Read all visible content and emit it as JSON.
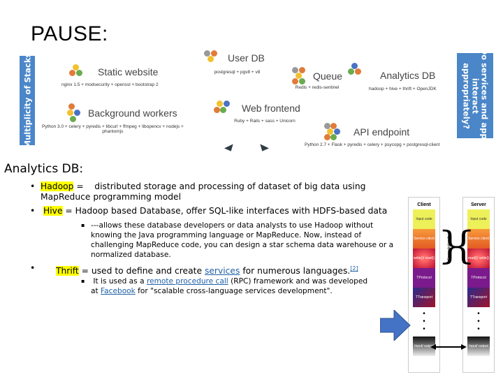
{
  "slide": {
    "title": "PAUSE:"
  },
  "diagram": {
    "left_banner": "Multiplicity of Stacks",
    "right_banner_lines": [
      "Do services and apps",
      "interact",
      "appropriately?"
    ],
    "services": [
      {
        "name": "Static website",
        "stack": "nginx 1.5 + modsecurity + openssl + bootstrap 2"
      },
      {
        "name": "User DB",
        "stack": "postgresql + pgv8 + v8"
      },
      {
        "name": "Queue",
        "stack": "Redis + redis-sentinel"
      },
      {
        "name": "Analytics DB",
        "stack": "hadoop + hive + thrift + OpenJDK"
      },
      {
        "name": "Background workers",
        "stack_lines": [
          "Python 3.0 + celery + pyredis + libcurl + ffmpeg + libopencv + nodejs +",
          "phantomjs"
        ]
      },
      {
        "name": "Web frontend",
        "stack": "Ruby + Rails + sass + Unicorn"
      },
      {
        "name": "API endpoint",
        "stack": "Python 2.7 + Flask + pyredis + celery + psycopg + postgresql-client"
      }
    ]
  },
  "content": {
    "heading": "Analytics DB:",
    "bullets": {
      "hadoop": {
        "term": "Hadoop",
        "text1": " =    distributed storage and processing of dataset of big data using",
        "text2": "MapReduce programming model"
      },
      "hive": {
        "term": "Hive",
        "text": " = Hadoop based Database, offer SQL-like interfaces with HDFS-based data"
      },
      "hive_sub": {
        "lines": [
          "---allows these database developers or data analysts to use Hadoop without",
          "knowing the Java programming language or MapReduce. Now, instead of",
          "challenging MapReduce code, you can design a star schema data warehouse or a",
          "normalized database."
        ]
      },
      "thrift": {
        "term": "Thrift",
        "text_a": " = used to define and create ",
        "link_services": "services",
        "text_b": " for numerous languages.",
        "ref": "[2]"
      },
      "thrift_sub": {
        "text_a": " It is used as a ",
        "link_rpc": "remote procedure call",
        "text_b": " (RPC) framework and was developed",
        "text_c": "at ",
        "link_fb": "Facebook",
        "text_d": " for \"scalable cross-language services development\"."
      }
    },
    "bullet_char": "•",
    "sub_bullet_char": "▪"
  },
  "thrift_diagram": {
    "client_title": "Client",
    "server_title": "Server",
    "generated_label": "Generated code",
    "blocks_client": [
      "Input code",
      "Service client",
      "write()/ read()",
      "TProtocol",
      "TTransport",
      "Input/ output"
    ],
    "blocks_server": [
      "Input code",
      "Service client",
      "read()/ write()",
      "TProtocol",
      "TTransport",
      "Input/ output"
    ],
    "dots": "•\n•\n•"
  }
}
